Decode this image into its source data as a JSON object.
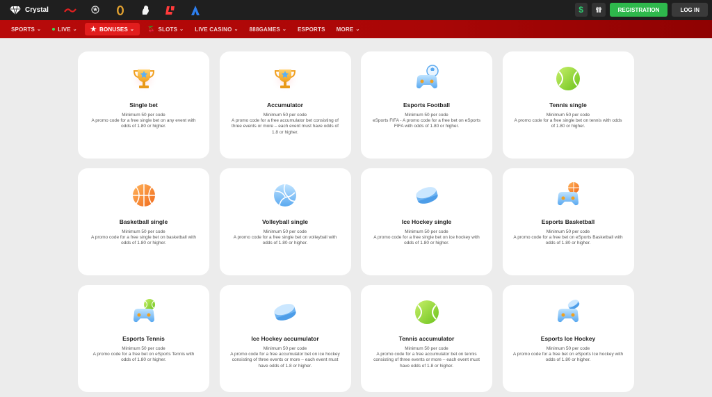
{
  "header": {
    "brand_name": "Crystal",
    "brand_icon": "diamond-icon",
    "partners": [
      "partner-logo-1",
      "champions-league-logo",
      "europa-league-logo",
      "premier-league-logo",
      "laliga-logo",
      "serie-a-logo"
    ],
    "dollar_symbol": "$",
    "registration_label": "REGISTRATION",
    "login_label": "LOG IN"
  },
  "nav": {
    "items": [
      {
        "label": "SPORTS"
      },
      {
        "label": "LIVE"
      },
      {
        "label": "BONUSES"
      },
      {
        "label": "SLOTS"
      },
      {
        "label": "LIVE CASINO"
      },
      {
        "label": "888GAMES"
      },
      {
        "label": "ESPORTS"
      },
      {
        "label": "MORE"
      }
    ]
  },
  "cards": [
    {
      "title": "Single bet",
      "min": "Minimum 50 per code",
      "desc": "A promo code for a free single bet on any event with odds of 1.80 or higher.",
      "icon": "trophy-icon"
    },
    {
      "title": "Accumulator",
      "min": "Minimum 50 per code",
      "desc": "A promo code for a free accumulator bet consisting of three events or more – each event must have odds of 1.8 or higher.",
      "icon": "trophy-icon"
    },
    {
      "title": "Esports Football",
      "min": "Minimum 50 per code",
      "desc": "eSports FIFA - A promo code for a free bet on eSports FIFA with odds of 1.80 or higher.",
      "icon": "gamepad-football-icon"
    },
    {
      "title": "Tennis single",
      "min": "Minimum 50 per code",
      "desc": "A promo code for a free single bet on tennis with odds of 1.80 or higher.",
      "icon": "tennis-ball-icon"
    },
    {
      "title": "Basketball single",
      "min": "Minimum 50 per code",
      "desc": "A promo code for a free single bet on basketball with odds of 1.80 or higher.",
      "icon": "basketball-icon"
    },
    {
      "title": "Volleyball single",
      "min": "Minimum 50 per code",
      "desc": "A promo code for a free single bet on volleyball with odds of 1.80 or higher.",
      "icon": "volleyball-icon"
    },
    {
      "title": "Ice Hockey single",
      "min": "Minimum 50 per code",
      "desc": "A promo code for a free single bet on ice hockey with odds of 1.80 or higher.",
      "icon": "hockey-puck-icon"
    },
    {
      "title": "Esports Basketball",
      "min": "Minimum 50 per code",
      "desc": "A promo code for a free bet on eSports Basketball with odds of 1.80 or higher.",
      "icon": "gamepad-basketball-icon"
    },
    {
      "title": "Esports Tennis",
      "min": "Minimum 50 per code",
      "desc": "A promo code for a free bet on eSports Tennis with odds of 1.80 or higher.",
      "icon": "gamepad-tennis-icon"
    },
    {
      "title": "Ice Hockey accumulator",
      "min": "Minimum 50 per code",
      "desc": "A promo code for a free accumulator bet on ice hockey consisting of three events or more – each event must have odds of 1.8 or higher.",
      "icon": "hockey-puck-icon"
    },
    {
      "title": "Tennis accumulator",
      "min": "Minimum 50 per code",
      "desc": "A promo code for a free accumulator bet on tennis consisting of three events or more – each event must have odds of 1.8 or higher.",
      "icon": "tennis-ball-icon"
    },
    {
      "title": "Esports Ice Hockey",
      "min": "Minimum 50 per code",
      "desc": "A promo code for a free bet on eSports Ice hockey with odds of 1.80 or higher.",
      "icon": "gamepad-hockey-icon"
    }
  ],
  "colors": {
    "topbar": "#1f1f1f",
    "navbar": "#b80a0a",
    "active_nav": "#e21d1d",
    "registration": "#2eb84c",
    "background": "#ececec"
  }
}
